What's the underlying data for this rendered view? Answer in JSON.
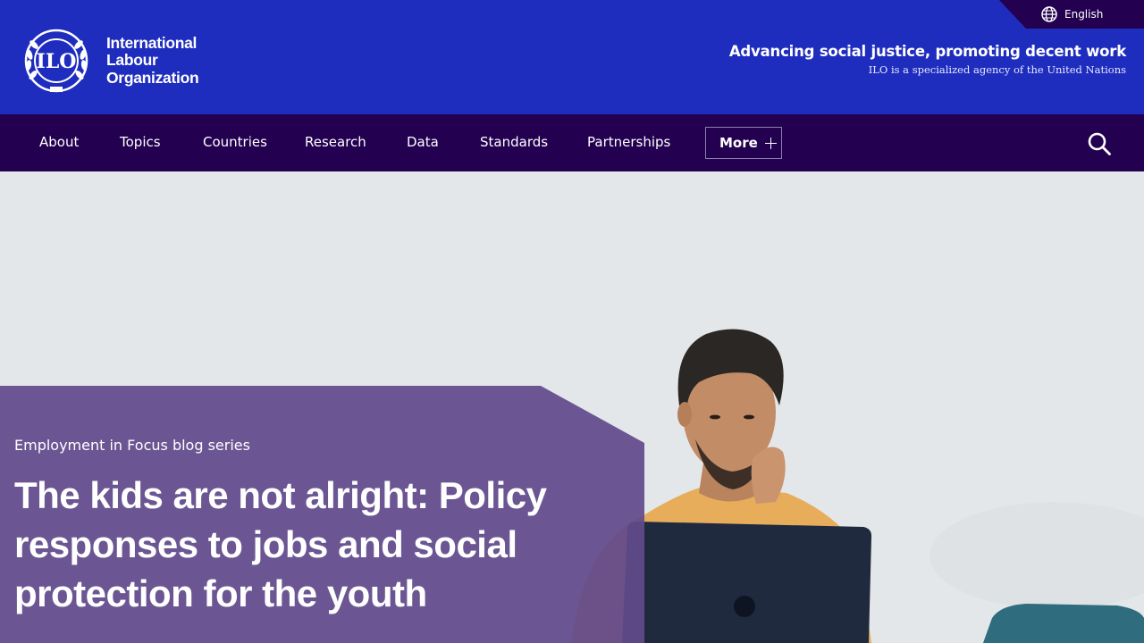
{
  "header": {
    "language": "English",
    "logo_lines": [
      "International",
      "Labour",
      "Organization"
    ],
    "logo_emblem_text": "ILO",
    "tagline": "Advancing social justice, promoting decent work",
    "subtagline": "ILO is a specialized agency of the United Nations"
  },
  "nav": {
    "items": [
      "About",
      "Topics",
      "Countries",
      "Research",
      "Data",
      "Standards",
      "Partnerships"
    ],
    "more_label": "More"
  },
  "hero": {
    "kicker": "Employment in Focus blog series",
    "title": "The kids are not alright: Policy responses to jobs and social protection for the youth"
  },
  "colors": {
    "header_blue": "#1e2dbe",
    "nav_purple": "#230050",
    "panel_purple": "#624a8c"
  },
  "icons": {
    "language": "globe-icon",
    "search": "search-icon",
    "more": "plus-icon"
  }
}
